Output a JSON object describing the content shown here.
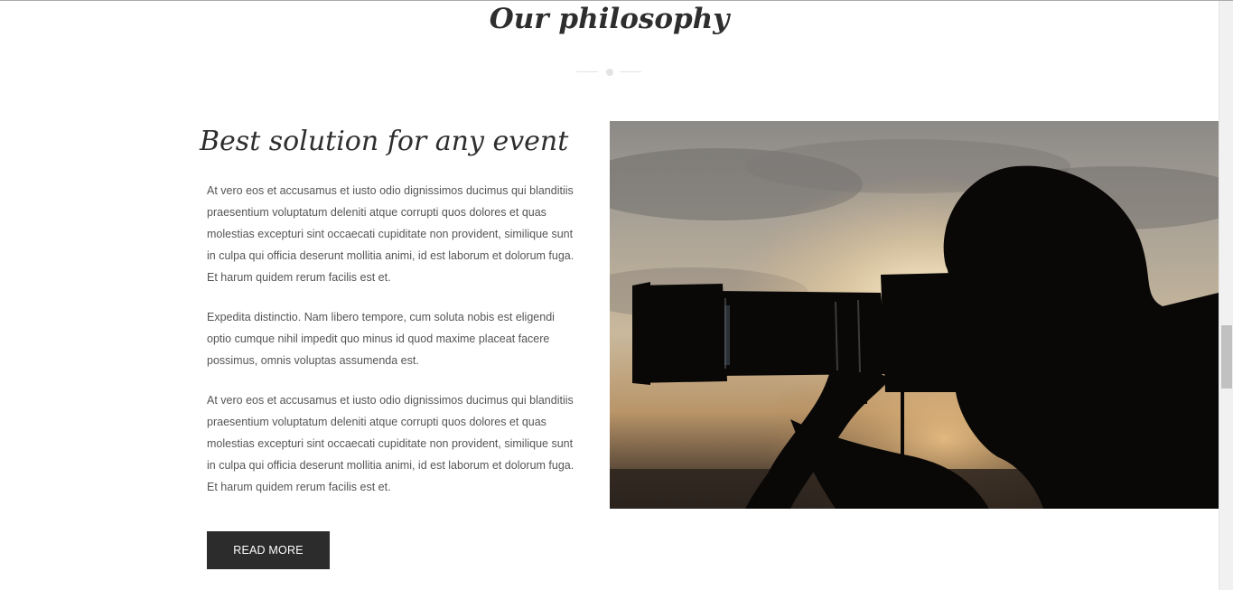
{
  "section": {
    "title": "Our philosophy"
  },
  "feature": {
    "heading": "Best solution for any event",
    "paragraphs": [
      "At vero eos et accusamus et iusto odio dignissimos ducimus qui blanditiis praesentium voluptatum deleniti atque corrupti quos dolores et quas molestias excepturi sint occaecati cupiditate non provident, similique sunt in culpa qui officia deserunt mollitia animi, id est laborum et dolorum fuga. Et harum quidem rerum facilis est et.",
      "Expedita distinctio. Nam libero tempore, cum soluta nobis est eligendi optio cumque nihil impedit quo minus id quod maxime placeat facere possimus, omnis voluptas assumenda est.",
      "At vero eos et accusamus et iusto odio dignissimos ducimus qui blanditiis praesentium voluptatum deleniti atque corrupti quos dolores et quas molestias excepturi sint occaecati cupiditate non provident, similique sunt in culpa qui officia deserunt mollitia animi, id est laborum et dolorum fuga. Et harum quidem rerum facilis est et."
    ],
    "button_label": "READ MORE",
    "image_icon": "photographer-silhouette-photo"
  },
  "colors": {
    "text_dark": "#2e2e2e",
    "text_body": "#555555",
    "button_bg": "#2c2c2c",
    "divider": "#e3e3e3"
  }
}
